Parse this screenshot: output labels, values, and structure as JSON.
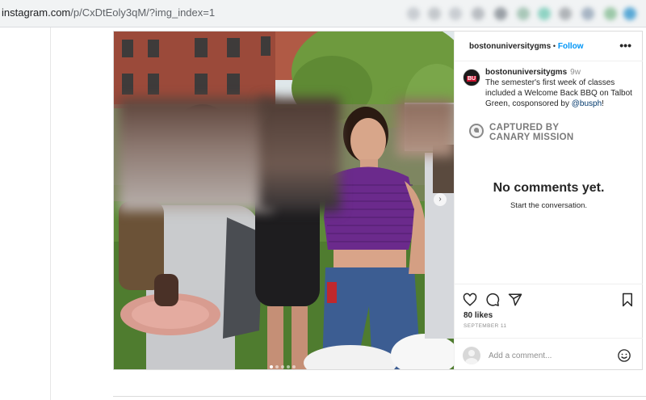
{
  "browser": {
    "url_host": "instagram.com",
    "url_path": "/p/CxDtEoly3qM/?img_index=1"
  },
  "post": {
    "header": {
      "username": "bostonuniversitygms",
      "separator": "•",
      "follow_label": "Follow",
      "more_label": "•••"
    },
    "caption": {
      "username": "bostonuniversitygms",
      "time": "9w",
      "text_before": "The semester's first week of classes included a Welcome Back BBQ on Talbot Green, cosponsored by ",
      "mention": "@busph",
      "text_after": "!"
    },
    "avatar_badge": "BU",
    "watermark": {
      "line1": "CAPTURED BY",
      "line2": "CANARY MISSION"
    },
    "comments": {
      "empty_title": "No comments yet.",
      "empty_subtitle": "Start the conversation."
    },
    "likes": "80 likes",
    "date": "SEPTEMBER 11",
    "add_comment_placeholder": "Add a comment...",
    "carousel": {
      "total": 5,
      "active_index": 0
    },
    "icons": [
      "heart-icon",
      "comment-icon",
      "share-icon",
      "bookmark-icon",
      "emoji-icon",
      "more-icon"
    ]
  }
}
